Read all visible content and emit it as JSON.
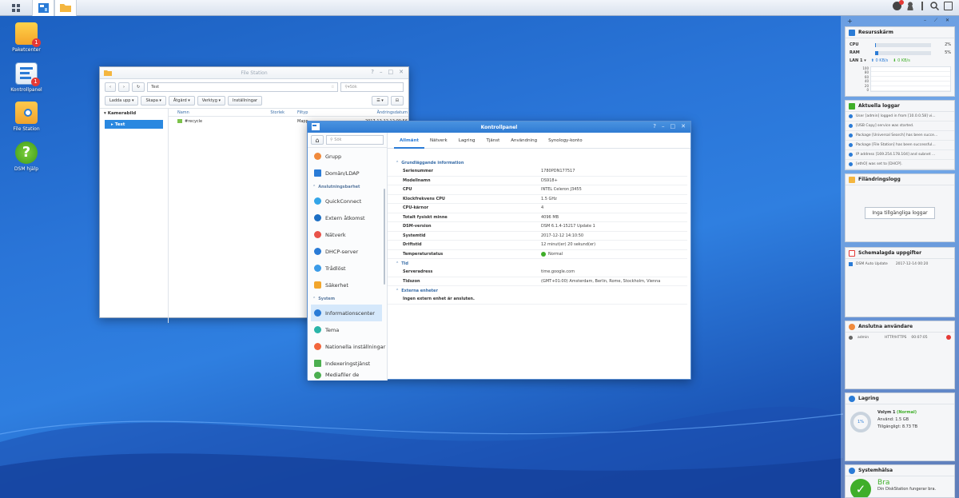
{
  "desktop": {
    "icons": [
      {
        "label": "Paketcenter",
        "badge": "1"
      },
      {
        "label": "Kontrollpanel",
        "badge": "1"
      },
      {
        "label": "File Station"
      },
      {
        "label": "DSM hjälp"
      }
    ]
  },
  "file_station": {
    "title": "File Station",
    "path": "Test",
    "search_placeholder": "Sök",
    "toolbar": [
      "Ladda upp",
      "Skapa",
      "Åtgärd",
      "Verktyg",
      "Inställningar"
    ],
    "tree_root": "Kamerabild",
    "tree_selected": "Test",
    "columns": [
      "Namn",
      "Storlek",
      "Filtyp",
      "Ändringsdatum"
    ],
    "rows": [
      {
        "name": "#recycle",
        "size": "",
        "type": "Mapp",
        "date": "2017-12-12 12:00:56"
      }
    ]
  },
  "control_panel": {
    "title": "Kontrollpanel",
    "search_placeholder": "Sök",
    "tabs": [
      "Allmänt",
      "Nätverk",
      "Lagring",
      "Tjänst",
      "Användning",
      "Synology-konto"
    ],
    "nav": {
      "item_grupp": "Grupp",
      "item_domain": "Domän/LDAP",
      "section_connect": "Anslutningsbarhet",
      "item_quickconnect": "QuickConnect",
      "item_external": "Extern åtkomst",
      "item_network": "Nätverk",
      "item_dhcp": "DHCP-server",
      "item_wireless": "Trådlöst",
      "item_security": "Säkerhet",
      "section_system": "System",
      "item_info": "Informationscenter",
      "item_theme": "Tema",
      "item_regional": "Nationella inställningar",
      "item_index": "Indexeringstjänst",
      "item_media": "Mediafiler de"
    },
    "sections": {
      "basic": "Grundläggande information",
      "time": "Tid",
      "external": "Externa enheter"
    },
    "basic_info": [
      {
        "key": "Serienummer",
        "value": "1780PDN177517"
      },
      {
        "key": "Modellnamn",
        "value": "DS918+"
      },
      {
        "key": "CPU",
        "value": "INTEL Celeron J3455"
      },
      {
        "key": "Klockfrekvens CPU",
        "value": "1.5 GHz"
      },
      {
        "key": "CPU-kärnor",
        "value": "4"
      },
      {
        "key": "Totalt fysiskt minne",
        "value": "4096 MB"
      },
      {
        "key": "DSM-version",
        "value": "DSM 6.1.4-15217 Update 1"
      },
      {
        "key": "Systemtid",
        "value": "2017-12-12 14:10:50"
      },
      {
        "key": "Driftstid",
        "value": "12 minut(er) 20 sekund(er)"
      },
      {
        "key": "Temperaturstatus",
        "value": "Normal"
      }
    ],
    "time_info": [
      {
        "key": "Serveradress",
        "value": "time.google.com"
      },
      {
        "key": "Tidszon",
        "value": "(GMT+01:00) Amsterdam, Berlin, Rome, Stockholm, Vienna"
      }
    ],
    "external_text": "Ingen extern enhet är ansluten."
  },
  "widgets": {
    "resource": {
      "title": "Resursskärm",
      "cpu_label": "CPU",
      "cpu_value": "2%",
      "cpu_pct": 2,
      "ram_label": "RAM",
      "ram_value": "5%",
      "ram_pct": 5,
      "lan_label": "LAN 1",
      "up": "0 KB/s",
      "down": "0 KB/s",
      "y_ticks": [
        "100",
        "80",
        "60",
        "40",
        "20",
        "0"
      ]
    },
    "logs": {
      "title": "Aktuella loggar",
      "rows": [
        "User [admin] logged in from [10.0.0.58] vi...",
        "[USB Copy] service was started.",
        "Package [Universal Search] has been succe...",
        "Package [File Station] has been successful...",
        "IP address [169.254.178.104] and subnet ...",
        "[ethO] was set to [DHCP]."
      ]
    },
    "file_log": {
      "title": "Filändringslogg",
      "button": "Inga tillgängliga loggar"
    },
    "tasks": {
      "title": "Schemalagda uppgifter",
      "name": "DSM Auto Update",
      "time": "2017-12-14 00:20"
    },
    "users": {
      "title": "Anslutna användare",
      "user": "admin",
      "proto": "HTTP/HTTPS",
      "duration": "00:07:05"
    },
    "storage": {
      "title": "Lagring",
      "pct_label": "1%",
      "pct": 1,
      "volume": "Volym 1",
      "status": "(Normal)",
      "used": "Använd: 1.5 GB",
      "avail": "Tillgängligt: 8.73 TB"
    },
    "health": {
      "title": "Systemhälsa",
      "status": "Bra",
      "desc": "Din DiskStation fungerar bra."
    }
  }
}
